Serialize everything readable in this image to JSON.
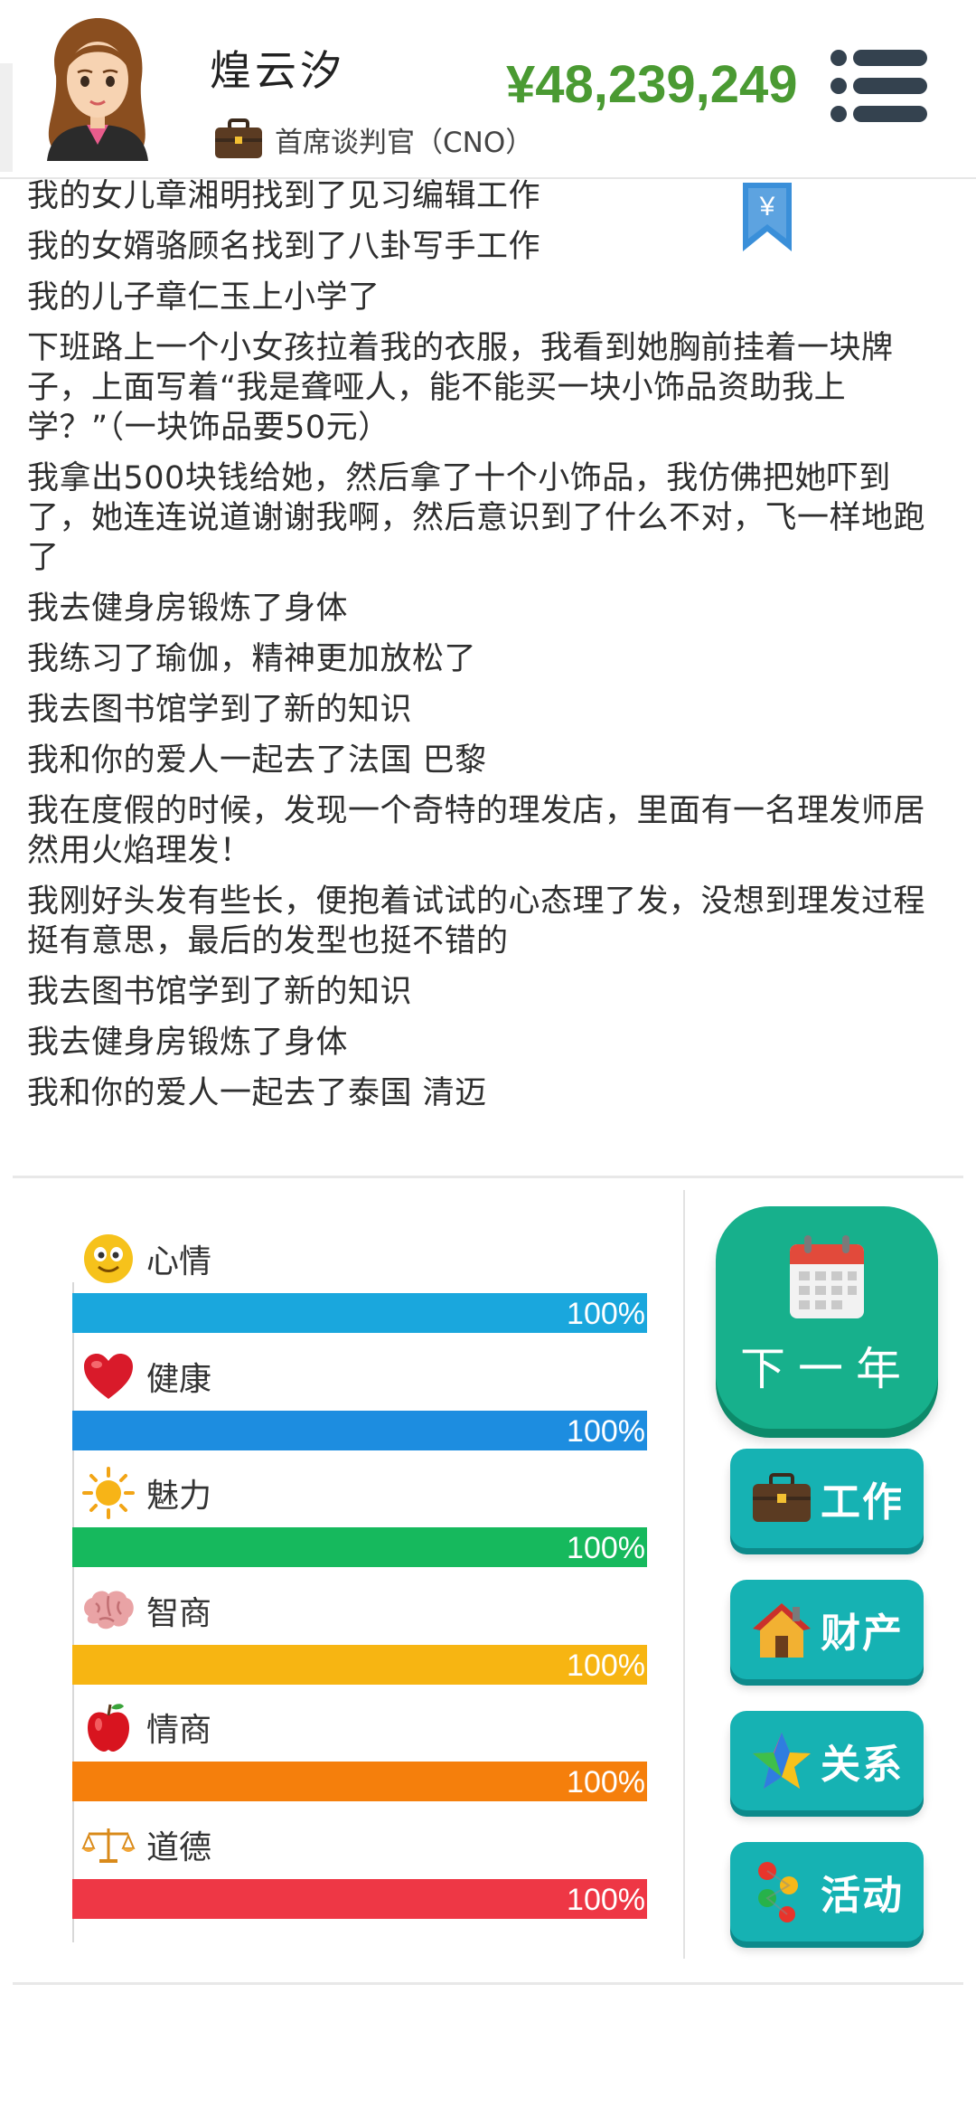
{
  "header": {
    "player_name": "煌云汐",
    "job_title": "首席谈判官（CNO）",
    "money": "¥48,239,249"
  },
  "events": [
    "我的女儿章湘明找到了见习编辑工作",
    "我的女婿骆顾名找到了八卦写手工作",
    "我的儿子章仁玉上小学了",
    "下班路上一个小女孩拉着我的衣服，我看到她胸前挂着一块牌子，上面写着“我是聋哑人，能不能买一块小饰品资助我上学？”（一块饰品要50元）",
    "我拿出500块钱给她，然后拿了十个小饰品，我仿佛把她吓到了，她连连说道谢谢我啊，然后意识到了什么不对，飞一样地跑了",
    "我去健身房锻炼了身体",
    "我练习了瑜伽，精神更加放松了",
    "我去图书馆学到了新的知识",
    "我和你的爱人一起去了法国 巴黎",
    "我在度假的时候，发现一个奇特的理发店，里面有一名理发师居然用火焰理发！",
    "我刚好头发有些长，便抱着试试的心态理了发，没想到理发过程挺有意思，最后的发型也挺不错的",
    "我去图书馆学到了新的知识",
    "我去健身房锻炼了身体",
    "我和你的爱人一起去了泰国 清迈"
  ],
  "bookmark_symbol": "¥",
  "stats": [
    {
      "label": "心情",
      "value": 100,
      "text": "100%",
      "color": "#1aa7dd",
      "icon": "smiley-icon"
    },
    {
      "label": "健康",
      "value": 100,
      "text": "100%",
      "color": "#1d8de0",
      "icon": "heart-icon"
    },
    {
      "label": "魅力",
      "value": 100,
      "text": "100%",
      "color": "#16b95d",
      "icon": "sun-icon"
    },
    {
      "label": "智商",
      "value": 100,
      "text": "100%",
      "color": "#f7b512",
      "icon": "brain-icon"
    },
    {
      "label": "情商",
      "value": 100,
      "text": "100%",
      "color": "#f57f0c",
      "icon": "apple-icon"
    },
    {
      "label": "道德",
      "value": 100,
      "text": "100%",
      "color": "#ee3745",
      "icon": "scales-icon"
    }
  ],
  "buttons": {
    "next_year": "下一年",
    "work": "工作",
    "property": "财产",
    "relations": "关系",
    "activity": "活动"
  }
}
